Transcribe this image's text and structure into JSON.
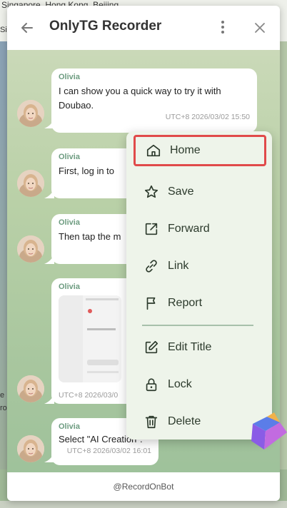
{
  "background": {
    "top_text": "Singapore, Hong Kong, Beijing",
    "side_fragments": [
      "Si",
      "e",
      "ro"
    ]
  },
  "header": {
    "title": "OnlyTG Recorder"
  },
  "messages": [
    {
      "sender": "Olivia",
      "lines": [
        "I can show you a quick way to try it with",
        "Doubao."
      ],
      "time": "UTC+8 2026/03/02 15:50"
    },
    {
      "sender": "Olivia",
      "lines": [
        "First, log in to"
      ]
    },
    {
      "sender": "Olivia",
      "lines": [
        "Then tap the m"
      ]
    },
    {
      "sender": "Olivia",
      "time": "UTC+8 2026/03/0"
    },
    {
      "sender": "Olivia",
      "lines": [
        "Select \"AI Creation\"."
      ],
      "time": "UTC+8 2026/03/02 16:01"
    }
  ],
  "context_menu": {
    "items": [
      {
        "label": "Home",
        "icon": "home-icon",
        "selected": true
      },
      {
        "label": "Save",
        "icon": "star-icon"
      },
      {
        "label": "Forward",
        "icon": "forward-icon"
      },
      {
        "label": "Link",
        "icon": "link-icon"
      },
      {
        "label": "Report",
        "icon": "flag-icon"
      },
      {
        "label": "Edit Title",
        "icon": "edit-icon"
      },
      {
        "label": "Lock",
        "icon": "lock-icon"
      },
      {
        "label": "Delete",
        "icon": "trash-icon"
      }
    ]
  },
  "footer": {
    "handle": "@RecordOnBot"
  },
  "colors": {
    "accent_green": "#6d9c80",
    "selected_outline": "#e04a4a",
    "menu_bg": "#eef4ea"
  }
}
